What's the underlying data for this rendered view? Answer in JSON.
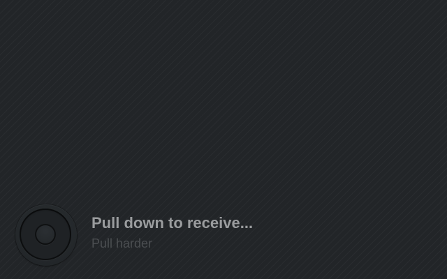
{
  "pull_to_receive": {
    "title": "Pull down to receive...",
    "subtitle": "Pull harder",
    "knob_icon": "pull-knob-icon"
  },
  "colors": {
    "background": "#222528",
    "title_text": "#9a9c9e",
    "subtitle_text": "#4b4e51"
  }
}
